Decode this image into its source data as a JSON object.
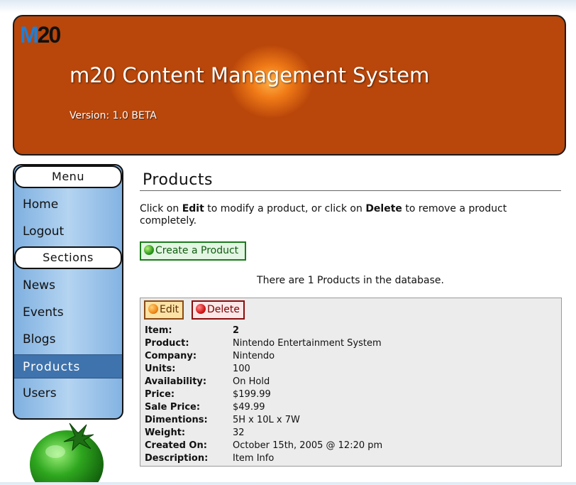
{
  "header": {
    "logo": {
      "m": "M",
      "n": "20"
    },
    "title": "m20 Content Management System",
    "version": "Version: 1.0 BETA"
  },
  "sidebar": {
    "menu_heading": "Menu",
    "menu_items": [
      {
        "label": "Home"
      },
      {
        "label": "Logout"
      }
    ],
    "sections_heading": "Sections",
    "section_items": [
      {
        "label": "News"
      },
      {
        "label": "Events"
      },
      {
        "label": "Blogs"
      },
      {
        "label": "Products",
        "active": true
      },
      {
        "label": "Users"
      }
    ]
  },
  "main": {
    "page_title": "Products",
    "instructions": {
      "part1": "Click on ",
      "edit": "Edit",
      "part2": " to modify a product, or click on ",
      "delete": "Delete",
      "part3": " to remove a product completely."
    },
    "create_button": "Create a Product",
    "count_text": "There are 1 Products in the database.",
    "product": {
      "edit_button": "Edit",
      "delete_button": "Delete",
      "fields": [
        {
          "label": "Item:",
          "value": "2"
        },
        {
          "label": "Product:",
          "value": "Nintendo Entertainment System"
        },
        {
          "label": "Company:",
          "value": "Nintendo"
        },
        {
          "label": "Units:",
          "value": "100"
        },
        {
          "label": "Availability:",
          "value": "On Hold"
        },
        {
          "label": "Price:",
          "value": "$199.99"
        },
        {
          "label": "Sale Price:",
          "value": "$49.99"
        },
        {
          "label": "Dimentions:",
          "value": "5H x 10L x 7W"
        },
        {
          "label": "Weight:",
          "value": "32"
        },
        {
          "label": "Created On:",
          "value": "October 15th, 2005 @ 12:20 pm"
        },
        {
          "label": "Description:",
          "value": "Item Info"
        }
      ]
    }
  },
  "icons": {
    "create": "green-tomato-icon",
    "edit": "orange-tomato-icon",
    "delete": "red-tomato-icon",
    "decoration": "green-tomato-illustration"
  },
  "colors": {
    "sidebar_blue": "#9cc4ea",
    "active_nav": "#3f73ad",
    "create_green": "#1b7a1b",
    "edit_orange": "#8b4a12",
    "delete_red": "#8a0d0d",
    "panel_gray": "#ececec"
  }
}
